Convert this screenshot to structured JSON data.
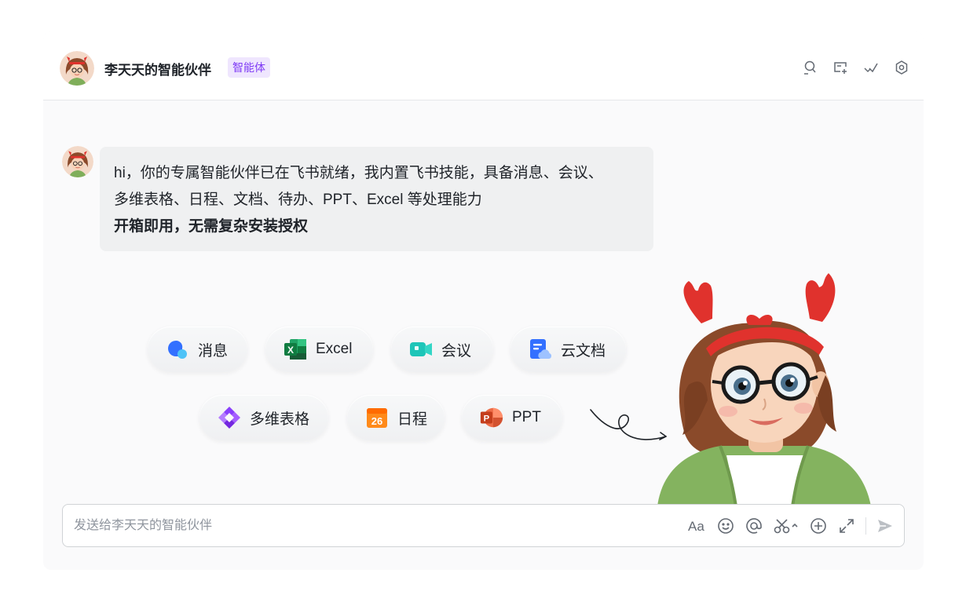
{
  "header": {
    "title": "李天天的智能伙伴",
    "badge": "智能体",
    "icons": [
      "search-user-icon",
      "new-topic-icon",
      "checklist-icon",
      "settings-icon"
    ]
  },
  "message": {
    "line1": "hi，你的专属智能伙伴已在飞书就绪，我内置飞书技能，具备消息、会议、",
    "line2": "多维表格、日程、文档、待办、PPT、Excel 等处理能力",
    "line3": "开箱即用，无需复杂安装授权"
  },
  "skills": {
    "row1": [
      {
        "label": "消息",
        "icon": "message-icon"
      },
      {
        "label": "Excel",
        "icon": "excel-icon"
      },
      {
        "label": "会议",
        "icon": "meeting-icon"
      },
      {
        "label": "云文档",
        "icon": "cloud-doc-icon"
      }
    ],
    "row2": [
      {
        "label": "多维表格",
        "icon": "base-icon"
      },
      {
        "label": "日程",
        "icon": "calendar-icon",
        "calendar_day": "26"
      },
      {
        "label": "PPT",
        "icon": "ppt-icon",
        "ppt_letter": "P"
      }
    ],
    "excel_letter": "X"
  },
  "composer": {
    "placeholder": "发送给李天天的智能伙伴",
    "font_tool": "Aa",
    "tools": [
      "text-format-icon",
      "emoji-icon",
      "mention-icon",
      "scissors-icon",
      "add-icon",
      "expand-icon",
      "send-icon"
    ]
  },
  "colors": {
    "accent": "#7f3bf5",
    "badge_bg": "#efe6fe",
    "bubble_bg": "#eff0f1",
    "message_blue": "#3370ff",
    "excel_green": "#1f7a45",
    "meeting_teal": "#1dc5b8",
    "calendar_orange": "#ff8a1a",
    "ppt_red": "#d24726"
  }
}
